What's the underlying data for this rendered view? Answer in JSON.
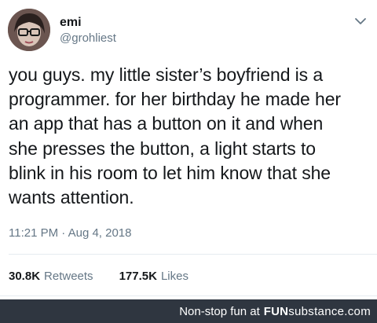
{
  "tweet": {
    "display_name": "emi",
    "handle": "@grohliest",
    "body": "you guys. my little sister’s boyfriend is a\nprogrammer. for her birthday he made her\nan app that has a button on it and when\nshe presses the button, a light starts to\nblink in his room to let him know that she\nwants attention.",
    "timestamp": "11:21 PM · Aug 4, 2018",
    "retweets_count": "30.8K",
    "retweets_label": "Retweets",
    "likes_count": "177.5K",
    "likes_label": "Likes",
    "caret_icon": "chevron-down-icon",
    "accent_color": "#657786"
  },
  "footer": {
    "tagline": "Non-stop fun at",
    "brand_bold": "FUN",
    "brand_rest": "substance.com",
    "background": "#2f3640"
  }
}
